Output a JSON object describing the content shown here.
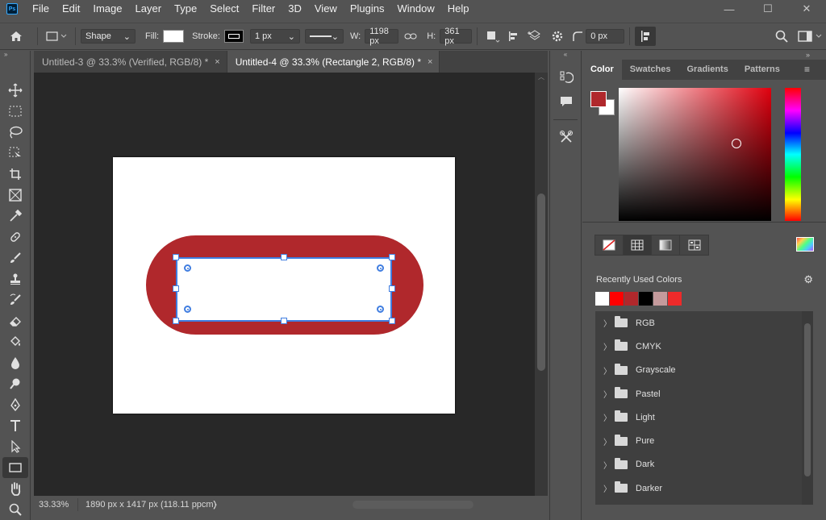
{
  "app": {
    "logo_text": "Ps"
  },
  "menu": [
    "File",
    "Edit",
    "Image",
    "Layer",
    "Type",
    "Select",
    "Filter",
    "3D",
    "View",
    "Plugins",
    "Window",
    "Help"
  ],
  "window_controls": {
    "minimize": "—",
    "maximize": "☐",
    "close": "✕"
  },
  "options": {
    "mode": "Shape",
    "fill_label": "Fill:",
    "stroke_label": "Stroke:",
    "stroke_width": "1 px",
    "w_label": "W:",
    "w_value": "1198 px",
    "h_label": "H:",
    "h_value": "361 px",
    "radius_value": "0 px"
  },
  "tabs": [
    {
      "label": "Untitled-3 @ 33.3% (Verified, RGB/8) *",
      "close": "×"
    },
    {
      "label": "Untitled-4 @ 33.3% (Rectangle 2, RGB/8) *",
      "close": "×"
    }
  ],
  "status": {
    "zoom": "33.33%",
    "doc_info": "1890 px x 1417 px (118.11 ppcm)",
    "arrow": "〉"
  },
  "colors": {
    "foreground": "#b0282c",
    "background": "#ffffff",
    "accent": "#3f7de0"
  },
  "color_panel": {
    "tabs": [
      "Color",
      "Swatches",
      "Gradients",
      "Patterns"
    ],
    "recent_label": "Recently Used Colors",
    "recent_colors": [
      "#ffffff",
      "#ff0000",
      "#b0282c",
      "#000000",
      "#c49a9c",
      "#ee2a2a"
    ],
    "folders": [
      "RGB",
      "CMYK",
      "Grayscale",
      "Pastel",
      "Light",
      "Pure",
      "Dark",
      "Darker"
    ]
  }
}
